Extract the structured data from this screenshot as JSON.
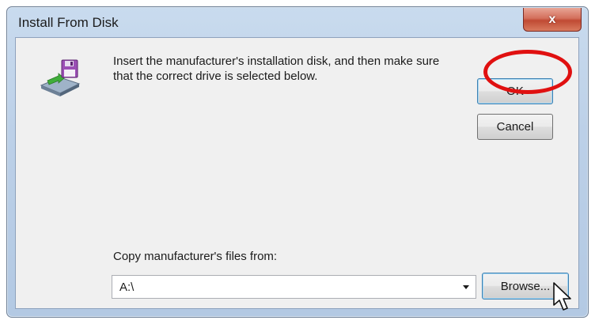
{
  "window": {
    "title": "Install From Disk",
    "close_glyph": "x"
  },
  "message": {
    "text": "Insert the manufacturer's installation disk, and then make sure that the correct drive is selected below."
  },
  "buttons": {
    "ok_label": "OK",
    "cancel_label": "Cancel",
    "browse_label": "Browse..."
  },
  "copy_from": {
    "label": "Copy manufacturer's files from:",
    "value": "A:\\"
  },
  "icons": {
    "disk": "floppy-disk-install-icon",
    "dropdown": "chevron-down-icon",
    "cursor": "mouse-pointer-icon"
  },
  "colors": {
    "highlight_ring": "#e01010",
    "close_button": "#c7503a",
    "title_bar": "#bcd0e8"
  }
}
